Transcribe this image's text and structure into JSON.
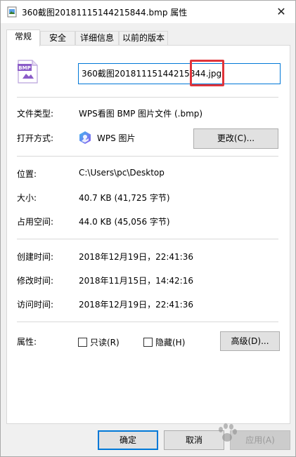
{
  "window": {
    "title": "360截图20181115144215844.bmp 属性",
    "close_glyph": "✕"
  },
  "tabs": [
    {
      "label": "常规",
      "active": true
    },
    {
      "label": "安全",
      "active": false
    },
    {
      "label": "详细信息",
      "active": false
    },
    {
      "label": "以前的版本",
      "active": false
    }
  ],
  "general": {
    "file_icon_badge": "BMP",
    "filename_value": "360截图20181115144215844.jpg",
    "file_type_label": "文件类型:",
    "file_type_value": "WPS看图 BMP 图片文件 (.bmp)",
    "open_with_label": "打开方式:",
    "open_with_app": "WPS 图片",
    "change_button": "更改(C)...",
    "location_label": "位置:",
    "location_value": "C:\\Users\\pc\\Desktop",
    "size_label": "大小:",
    "size_value": "40.7 KB (41,725 字节)",
    "disk_size_label": "占用空间:",
    "disk_size_value": "44.0 KB (45,056 字节)",
    "created_label": "创建时间:",
    "created_value": "2018年12月19日，22:41:36",
    "modified_label": "修改时间:",
    "modified_value": "2018年11月15日，14:42:16",
    "accessed_label": "访问时间:",
    "accessed_value": "2018年12月19日，22:41:36",
    "attributes_label": "属性:",
    "readonly_label": "只读(R)",
    "hidden_label": "隐藏(H)",
    "advanced_button": "高级(D)..."
  },
  "footer": {
    "ok_button": "确定",
    "cancel_button": "取消",
    "apply_button": "应用(A)"
  },
  "colors": {
    "accent": "#0078d7",
    "highlight": "#e0343a",
    "bmp_purple": "#8b5cc8"
  },
  "icons": {
    "file": "bmp-file-icon",
    "app": "wps-picture-icon",
    "title": "image-file-icon"
  }
}
